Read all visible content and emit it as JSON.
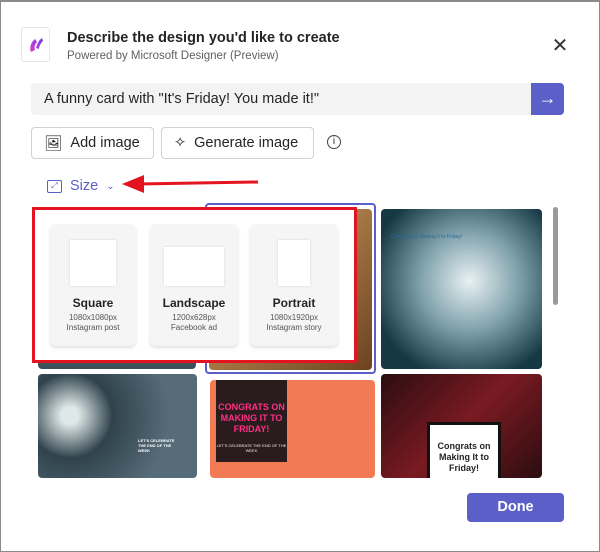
{
  "header": {
    "title": "Describe the design you'd like to create",
    "subtitle": "Powered by Microsoft Designer (Preview)"
  },
  "prompt": {
    "value": "A funny card with \"It's Friday! You made it!\""
  },
  "buttons": {
    "add_image": "Add image",
    "generate_image": "Generate image",
    "done": "Done"
  },
  "size": {
    "label": "Size"
  },
  "size_options": [
    {
      "name": "Square",
      "dims": "1080x1080px",
      "use": "Instagram post"
    },
    {
      "name": "Landscape",
      "dims": "1200x628px",
      "use": "Facebook ad"
    },
    {
      "name": "Portrait",
      "dims": "1080x1920px",
      "use": "Instagram story"
    }
  ],
  "designs": {
    "d3": "Congrats on Making It to Friday!",
    "d4": "LET'S CELEBRATE THE END OF THE WEEK",
    "d5_title": "CONGRATS ON MAKING IT TO FRIDAY!",
    "d5_sub": "LET'S CELEBRATE THE END OF THE WEEK",
    "d6": "Congrats on Making It to Friday!"
  },
  "colors": {
    "accent": "#5b5fc7",
    "annotation": "#e3141f"
  }
}
